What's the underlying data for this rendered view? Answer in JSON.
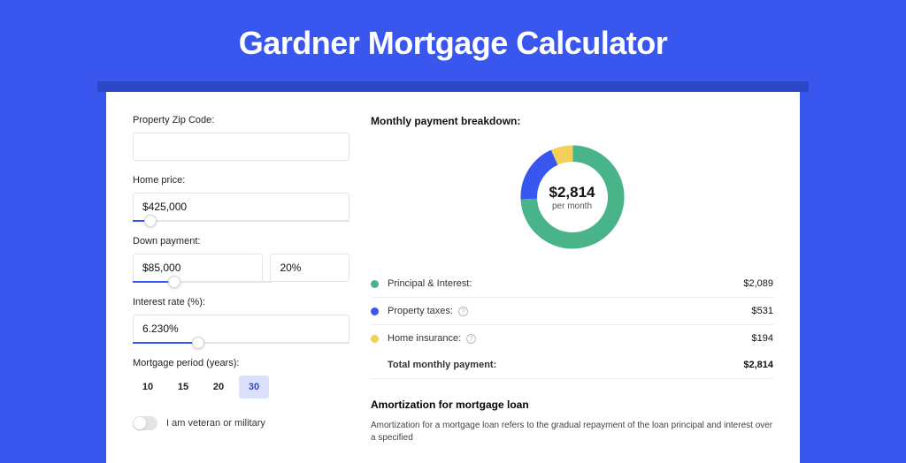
{
  "title": "Gardner Mortgage Calculator",
  "form": {
    "zip_label": "Property Zip Code:",
    "zip_value": "",
    "price_label": "Home price:",
    "price_value": "$425,000",
    "price_slider": {
      "fill_pct": 8
    },
    "down_label": "Down payment:",
    "down_value": "$85,000",
    "down_pct": "20%",
    "down_slider": {
      "fill_pct": 20
    },
    "rate_label": "Interest rate (%):",
    "rate_value": "6.230%",
    "rate_slider": {
      "fill_pct": 30
    },
    "period_label": "Mortgage period (years):",
    "periods": [
      "10",
      "15",
      "20",
      "30"
    ],
    "period_selected": "30",
    "veteran_label": "I am veteran or military"
  },
  "breakdown": {
    "heading": "Monthly payment breakdown:",
    "total_amount": "$2,814",
    "total_sub": "per month",
    "rows": [
      {
        "label": "Principal & Interest:",
        "value": "$2,089",
        "color": "#49b38a",
        "info": false
      },
      {
        "label": "Property taxes:",
        "value": "$531",
        "color": "#3957ef",
        "info": true
      },
      {
        "label": "Home insurance:",
        "value": "$194",
        "color": "#f3cf5a",
        "info": true
      }
    ],
    "total_row": {
      "label": "Total monthly payment:",
      "value": "$2,814"
    }
  },
  "chart_data": {
    "type": "pie",
    "title": "Monthly payment breakdown",
    "series": [
      {
        "name": "Principal & Interest",
        "value": 2089,
        "color": "#49b38a"
      },
      {
        "name": "Property taxes",
        "value": 531,
        "color": "#3957ef"
      },
      {
        "name": "Home insurance",
        "value": 194,
        "color": "#f3cf5a"
      }
    ],
    "total": 2814,
    "center_label": "$2,814 per month"
  },
  "amort": {
    "heading": "Amortization for mortgage loan",
    "body": "Amortization for a mortgage loan refers to the gradual repayment of the loan principal and interest over a specified"
  }
}
